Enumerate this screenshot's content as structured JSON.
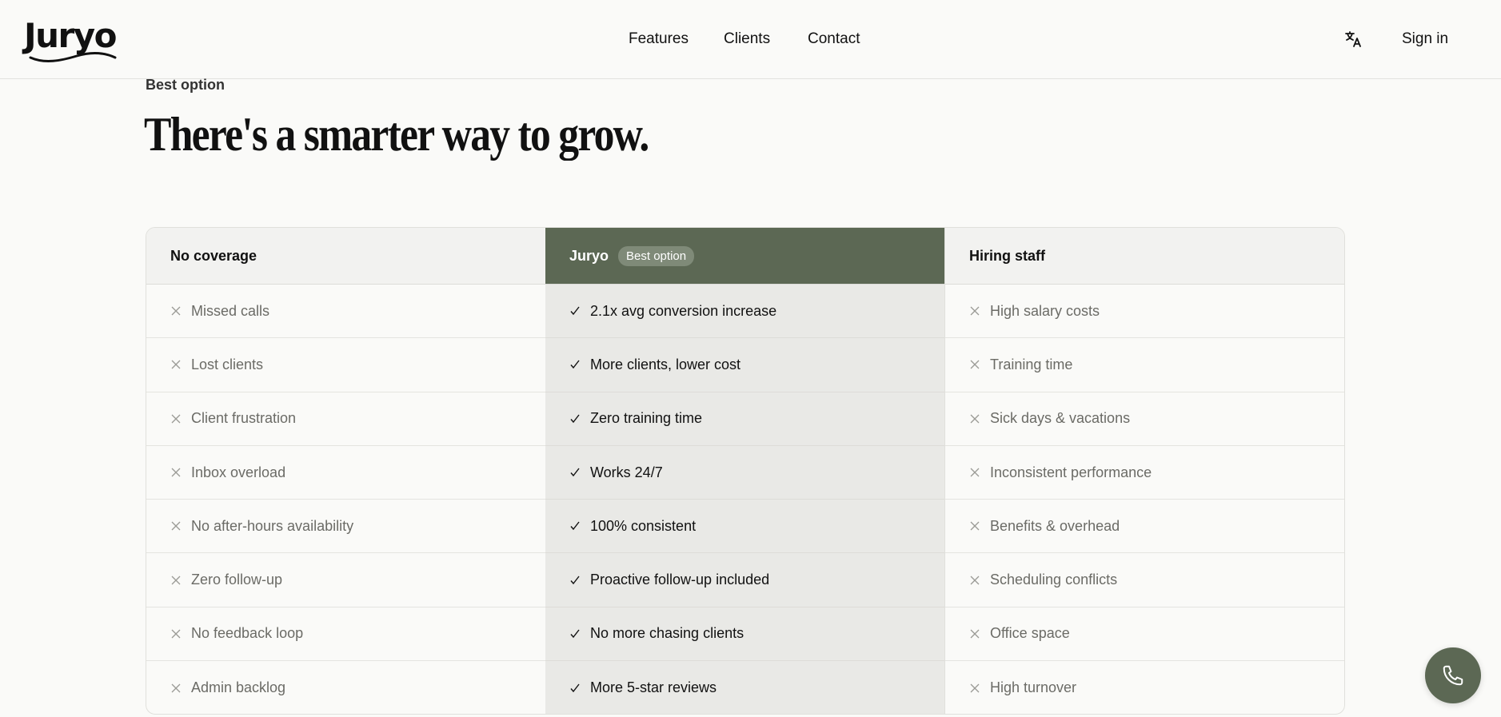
{
  "brand": {
    "name": "Juryo"
  },
  "nav": {
    "features": "Features",
    "clients": "Clients",
    "contact": "Contact",
    "signin": "Sign in"
  },
  "section": {
    "eyebrow": "Best option",
    "headline": "There's a smarter way to grow."
  },
  "comparison": {
    "columns": [
      {
        "title": "No coverage",
        "items": [
          "Missed calls",
          "Lost clients",
          "Client frustration",
          "Inbox overload",
          "No after-hours availability",
          "Zero follow-up",
          "No feedback loop",
          "Admin backlog"
        ]
      },
      {
        "title": "Juryo",
        "badge": "Best option",
        "items": [
          "2.1x avg conversion increase",
          "More clients, lower cost",
          "Zero training time",
          "Works 24/7",
          "100% consistent",
          "Proactive follow-up included",
          "No more chasing clients",
          "More 5-star reviews"
        ]
      },
      {
        "title": "Hiring staff",
        "items": [
          "High salary costs",
          "Training time",
          "Sick days & vacations",
          "Inconsistent performance",
          "Benefits & overhead",
          "Scheduling conflicts",
          "Office space",
          "High turnover"
        ]
      }
    ]
  },
  "colors": {
    "accent": "#5c6854",
    "highlight_column": "#e9e9e6"
  },
  "icons": {
    "translate": "translate-icon",
    "call": "phone-icon",
    "cross": "x-icon",
    "check": "check-icon"
  }
}
